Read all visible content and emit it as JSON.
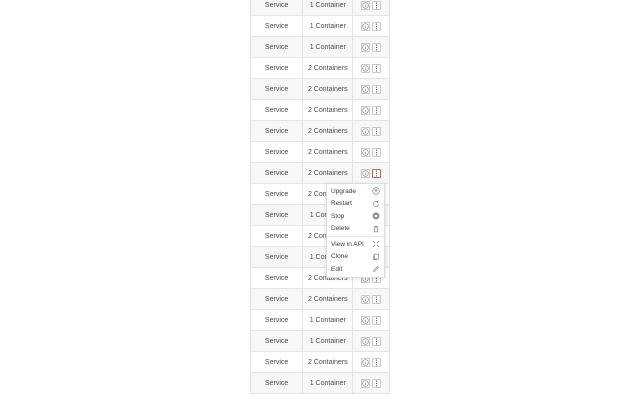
{
  "rows": [
    {
      "type": "Service",
      "scale": "1 Container"
    },
    {
      "type": "Service",
      "scale": "1 Container"
    },
    {
      "type": "Service",
      "scale": "1 Container"
    },
    {
      "type": "Service",
      "scale": "2 Containers"
    },
    {
      "type": "Service",
      "scale": "2 Containers"
    },
    {
      "type": "Service",
      "scale": "2 Containers"
    },
    {
      "type": "Service",
      "scale": "2 Containers"
    },
    {
      "type": "Service",
      "scale": "2 Containers"
    },
    {
      "type": "Service",
      "scale": "2 Containers"
    },
    {
      "type": "Service",
      "scale": "2 Containers"
    },
    {
      "type": "Service",
      "scale": "1 Container"
    },
    {
      "type": "Service",
      "scale": "2 Containers"
    },
    {
      "type": "Service",
      "scale": "1 Container"
    },
    {
      "type": "Service",
      "scale": "2 Containers"
    },
    {
      "type": "Service",
      "scale": "2 Containers"
    },
    {
      "type": "Service",
      "scale": "1 Container"
    },
    {
      "type": "Service",
      "scale": "1 Container"
    },
    {
      "type": "Service",
      "scale": "2 Containers"
    },
    {
      "type": "Service",
      "scale": "1 Container"
    }
  ],
  "row_buttons": {
    "info_icon": "info-circle-icon",
    "more_icon": "vertical-ellipsis-icon"
  },
  "menu": {
    "items": [
      {
        "label": "Upgrade",
        "icon": "upgrade-icon"
      },
      {
        "label": "Restart",
        "icon": "restart-icon"
      },
      {
        "label": "Stop",
        "icon": "stop-icon"
      },
      {
        "label": "Delete",
        "icon": "trash-icon"
      },
      {
        "label": "View in API",
        "icon": "external-link-icon"
      },
      {
        "label": "Clone",
        "icon": "clone-icon"
      },
      {
        "label": "Edit",
        "icon": "pencil-icon"
      }
    ]
  },
  "colors": {
    "active_border": "#e0584a",
    "row_alt": "#f6f7f9",
    "border": "#e3e3e3"
  }
}
